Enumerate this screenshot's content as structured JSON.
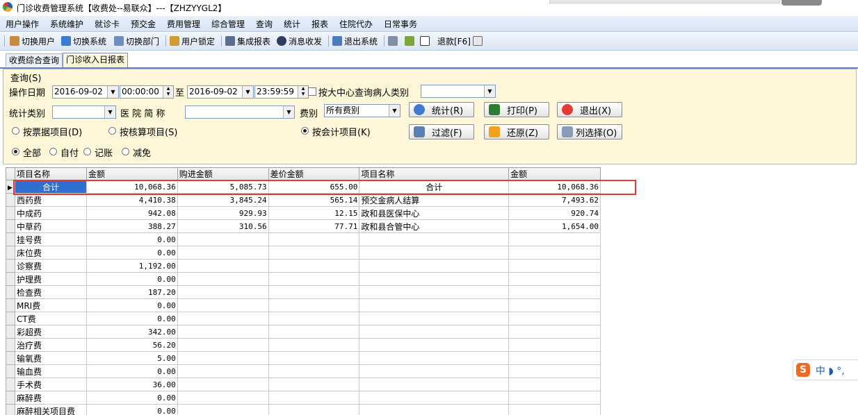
{
  "window": {
    "title": "门诊收费管理系统【收费处--易联众】---【ZHZYYGL2】"
  },
  "menu": [
    "用户操作",
    "系统维护",
    "就诊卡",
    "预交金",
    "费用管理",
    "综合管理",
    "查询",
    "统计",
    "报表",
    "住院代办",
    "日常事务"
  ],
  "toolbar": {
    "switch_user": "切换用户",
    "switch_system": "切换系统",
    "switch_dept": "切换部门",
    "lock_user": "用户锁定",
    "integrated_report": "集成报表",
    "message": "消息收发",
    "exit_system": "退出系统",
    "refund": "退款[F6]"
  },
  "tabs": [
    "收费综合查询",
    "门诊收入日报表"
  ],
  "query": {
    "group_title": "查询(S)",
    "op_date_label": "操作日期",
    "start_date": "2016-09-02",
    "start_time": "00:00:00",
    "to_label": "至",
    "end_date": "2016-09-02",
    "end_time": "23:59:59",
    "center_query_label": "按大中心查询病人类别",
    "center_query_value": "",
    "stat_type_label": "统计类别",
    "stat_type_value": "",
    "hospital_label": "医 院 简 称",
    "hospital_value": "",
    "fee_type_label": "费别",
    "fee_type_value": "所有费别",
    "radio_bill": "按票据项目(D)",
    "radio_audit": "按核算项目(S)",
    "radio_account": "按会计项目(K)",
    "radio_all": "全部",
    "radio_self": "自付",
    "radio_charge": "记账",
    "radio_exempt": "减免"
  },
  "buttons": {
    "stat": "统计(R)",
    "print": "打印(P)",
    "exit": "退出(X)",
    "filter": "过滤(F)",
    "restore": "还原(Z)",
    "column_select": "列选择(O)"
  },
  "grid": {
    "headers": [
      "项目名称",
      "金额",
      "购进金额",
      "差价金额",
      "项目名称",
      "金额"
    ],
    "rows": [
      [
        "合计",
        "10,068.36",
        "5,085.73",
        "655.00",
        "合计",
        "10,068.36"
      ],
      [
        "西药费",
        "4,410.38",
        "3,845.24",
        "565.14",
        "预交金病人结算",
        "7,493.62"
      ],
      [
        "中成药",
        "942.08",
        "929.93",
        "12.15",
        "政和县医保中心",
        "920.74"
      ],
      [
        "中草药",
        "388.27",
        "310.56",
        "77.71",
        "政和县合管中心",
        "1,654.00"
      ],
      [
        "挂号费",
        "0.00",
        "",
        "",
        "",
        ""
      ],
      [
        "床位费",
        "0.00",
        "",
        "",
        "",
        ""
      ],
      [
        "诊察费",
        "1,192.00",
        "",
        "",
        "",
        ""
      ],
      [
        "护理费",
        "0.00",
        "",
        "",
        "",
        ""
      ],
      [
        "检查费",
        "187.20",
        "",
        "",
        "",
        ""
      ],
      [
        "MRI费",
        "0.00",
        "",
        "",
        "",
        ""
      ],
      [
        "CT费",
        "0.00",
        "",
        "",
        "",
        ""
      ],
      [
        "彩超费",
        "342.00",
        "",
        "",
        "",
        ""
      ],
      [
        "治疗费",
        "56.20",
        "",
        "",
        "",
        ""
      ],
      [
        "输氧费",
        "5.00",
        "",
        "",
        "",
        ""
      ],
      [
        "输血费",
        "0.00",
        "",
        "",
        "",
        ""
      ],
      [
        "手术费",
        "36.00",
        "",
        "",
        "",
        ""
      ],
      [
        "麻醉费",
        "0.00",
        "",
        "",
        "",
        ""
      ],
      [
        "麻醉相关项目费",
        "0.00",
        "",
        "",
        "",
        ""
      ]
    ]
  },
  "ime": {
    "logo": "S",
    "text": "中 ◗ °,"
  }
}
